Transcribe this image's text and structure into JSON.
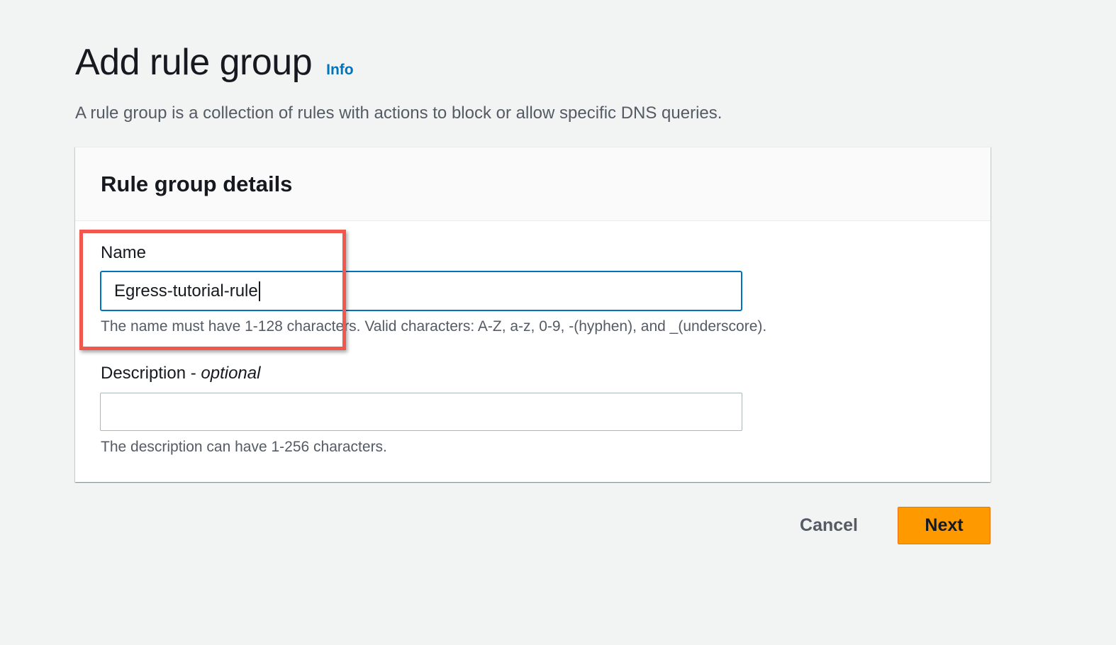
{
  "header": {
    "title": "Add rule group",
    "info_link": "Info",
    "description": "A rule group is a collection of rules with actions to block or allow specific DNS queries."
  },
  "panel": {
    "title": "Rule group details",
    "name_field": {
      "label": "Name",
      "value": "Egress-tutorial-rule",
      "hint": "The name must have 1-128 characters. Valid characters: A-Z, a-z, 0-9, -(hyphen), and _(underscore)."
    },
    "description_field": {
      "label": "Description - ",
      "label_optional": "optional",
      "value": "",
      "hint": "The description can have 1-256 characters."
    }
  },
  "actions": {
    "cancel_label": "Cancel",
    "next_label": "Next"
  },
  "colors": {
    "primary_button": "#ff9900",
    "link": "#0073bb",
    "focus_border": "#0073bb",
    "highlight_annotation": "#f2574d"
  }
}
